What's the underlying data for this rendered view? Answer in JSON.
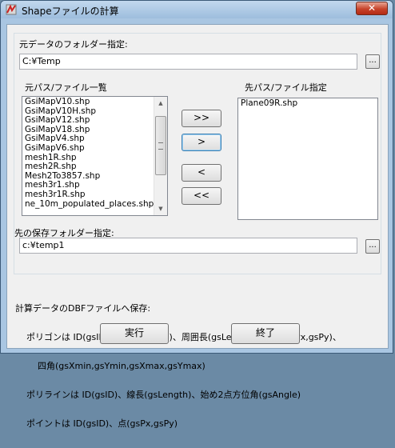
{
  "window": {
    "title": "Shapeファイルの計算",
    "close_label": "✕"
  },
  "source_folder": {
    "label": "元データのフォルダー指定:",
    "value": "C:¥Temp",
    "browse_label": "..."
  },
  "source_list": {
    "label": "元パス/ファイル一覧",
    "items": [
      "GsiMapV10.shp",
      "GsiMapV10H.shp",
      "GsiMapV12.shp",
      "GsiMapV18.shp",
      "GsiMapV4.shp",
      "GsiMapV6.shp",
      "mesh1R.shp",
      "mesh2R.shp",
      "Mesh2To3857.shp",
      "mesh3r1.shp",
      "mesh3r1R.shp",
      "ne_10m_populated_places.shp"
    ]
  },
  "dest_list": {
    "label": "先パス/ファイル指定",
    "items": [
      "Plane09R.shp"
    ]
  },
  "move_buttons": {
    "add_all": ">>",
    "add_one": ">",
    "remove_one": "<",
    "remove_all": "<<"
  },
  "dest_folder": {
    "label": "先の保存フォルダー指定:",
    "value": "c:¥temp1",
    "browse_label": "..."
  },
  "info": {
    "line1": "計算データのDBFファイルへ保存:",
    "line2": "    ポリゴンは ID(gsID)、面積(gsArea)、周囲長(gsLeghth)、重心(gsPx,gsPy)、",
    "line3": "        四角(gsXmin,gsYmin,gsXmax,gsYmax)",
    "line4": "    ポリラインは ID(gsID)、線長(gsLength)、始め2点方位角(gsAngle)",
    "line5": "    ポイントは ID(gsID)、点(gsPx,gsPy)"
  },
  "actions": {
    "run_label": "実行",
    "exit_label": "終了"
  }
}
